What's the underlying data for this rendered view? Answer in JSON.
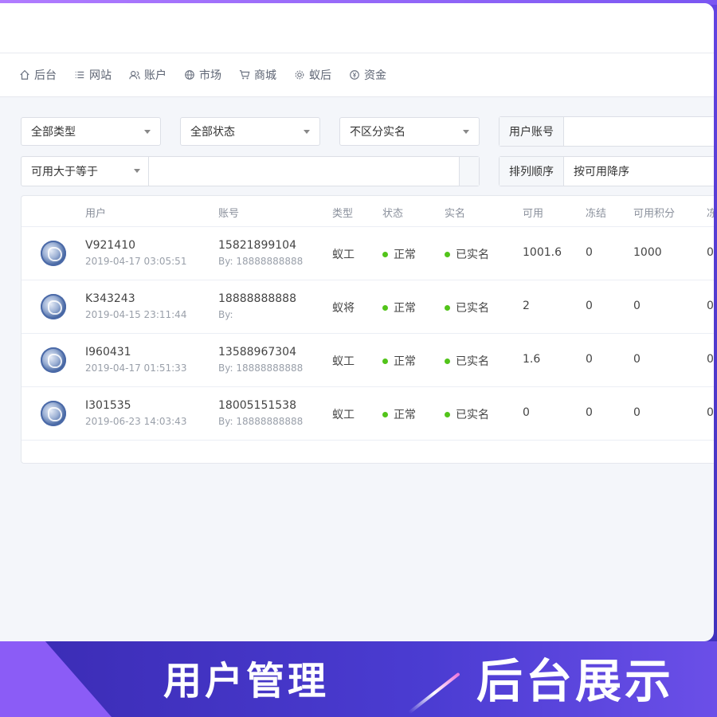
{
  "nav": [
    {
      "label": "后台",
      "icon": "home-icon"
    },
    {
      "label": "网站",
      "icon": "list-icon"
    },
    {
      "label": "账户",
      "icon": "users-icon"
    },
    {
      "label": "市场",
      "icon": "globe-icon"
    },
    {
      "label": "商城",
      "icon": "cart-icon"
    },
    {
      "label": "蚁后",
      "icon": "gear-icon"
    },
    {
      "label": "资金",
      "icon": "coin-icon"
    }
  ],
  "filters": {
    "type_select": "全部类型",
    "status_select": "全部状态",
    "realname_select": "不区分实名",
    "account_label": "用户账号",
    "account_value": "",
    "available_select": "可用大于等于",
    "available_value": "",
    "sort_label": "排列顺序",
    "sort_value": "按可用降序"
  },
  "table": {
    "headers": [
      "用户",
      "账号",
      "类型",
      "状态",
      "实名",
      "可用",
      "冻结",
      "可用积分",
      "冻"
    ],
    "rows": [
      {
        "user": "V921410",
        "time": "2019-04-17 03:05:51",
        "account": "15821899104",
        "by": "By: 18888888888",
        "type": "蚁工",
        "status": "正常",
        "realname": "已实名",
        "available": "1001.6",
        "frozen": "0",
        "points": "1000",
        "frozen_points": "0"
      },
      {
        "user": "K343243",
        "time": "2019-04-15 23:11:44",
        "account": "18888888888",
        "by": "By:",
        "type": "蚁将",
        "status": "正常",
        "realname": "已实名",
        "available": "2",
        "frozen": "0",
        "points": "0",
        "frozen_points": "0"
      },
      {
        "user": "I960431",
        "time": "2019-04-17 01:51:33",
        "account": "13588967304",
        "by": "By: 18888888888",
        "type": "蚁工",
        "status": "正常",
        "realname": "已实名",
        "available": "1.6",
        "frozen": "0",
        "points": "0",
        "frozen_points": "0"
      },
      {
        "user": "I301535",
        "time": "2019-06-23 14:03:43",
        "account": "18005151538",
        "by": "By: 18888888888",
        "type": "蚁工",
        "status": "正常",
        "realname": "已实名",
        "available": "0",
        "frozen": "0",
        "points": "0",
        "frozen_points": "0"
      }
    ]
  },
  "promo": {
    "left": "用户管理",
    "right": "后台展示"
  },
  "colors": {
    "accent": "#6a48ea",
    "status_green": "#52c41a"
  }
}
